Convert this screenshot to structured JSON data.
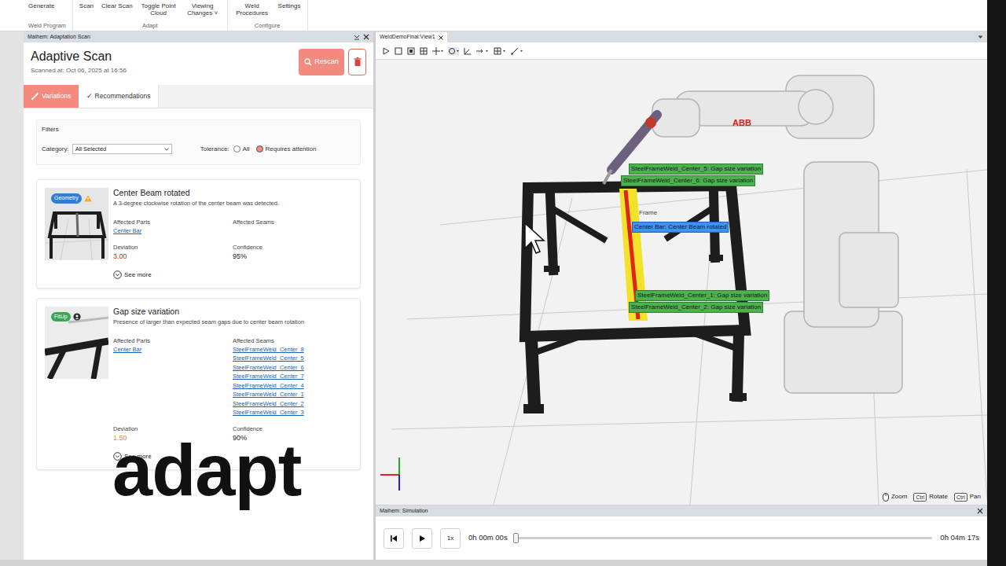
{
  "ribbon": {
    "groups": [
      {
        "label": "Weld Program",
        "items": [
          "Generate"
        ]
      },
      {
        "label": "Adapt",
        "items": [
          "Scan",
          "Clear Scan",
          "Toggle Point Cloud",
          "Viewing Changes ˅"
        ]
      },
      {
        "label": "Configure",
        "items": [
          "Weld Procedures",
          "Settings"
        ]
      }
    ]
  },
  "scan_panel": {
    "title": "Maihem: Adaptation Scan",
    "heading": "Adaptive Scan",
    "scanned_at": "Scanned at: Oct 06, 2025 at 16:56",
    "rescan": "Rescan",
    "tabs": [
      {
        "label": "Variations",
        "selected": true,
        "kind": "icon"
      },
      {
        "label": "✓ Recommendations",
        "selected": false,
        "kind": "plain"
      }
    ],
    "filters": {
      "title": "Filters",
      "category_label": "Category:",
      "category": "All Selected",
      "tolerance_label": "Tolerance:",
      "tolerance": [
        {
          "label": "All",
          "selected": false
        },
        {
          "label": "Requires attention",
          "selected": true
        }
      ]
    },
    "variations": [
      {
        "title": "Center Beam rotated",
        "description": "A 3-degree clockwise rotation of the center beam was detected.",
        "badge": "Geometry",
        "badge_color": "#2f7fd8",
        "flag": "warning",
        "thumb": "frame",
        "parts_label": "Affected Parts",
        "parts": [
          "Center Bar"
        ],
        "seams_label": "Affected Seams",
        "seams": [],
        "deviation_label": "Deviation",
        "deviation": "3.00",
        "deviation_color": "#b83228",
        "confidence_label": "Confidence",
        "confidence": "95%",
        "see_more": "See more"
      },
      {
        "title": "Gap size variation",
        "description": "Presence of larger than expected seam gaps due to center beam rotation",
        "badge": "FitUp",
        "badge_color": "#3aa655",
        "flag": "person",
        "thumb": "closeup",
        "parts_label": "Affected Parts",
        "parts": [
          "Center Bar"
        ],
        "seams_label": "Affected Seams",
        "seams": [
          "SteelFrameWeld_Center_8",
          "SteelFrameWeld_Center_5",
          "SteelFrameWeld_Center_6",
          "SteelFrameWeld_Center_7",
          "SteelFrameWeld_Center_4",
          "SteelFrameWeld_Center_1",
          "SteelFrameWeld_Center_2",
          "SteelFrameWeld_Center_3"
        ],
        "deviation_label": "Deviation",
        "deviation": "1.50",
        "deviation_color": "#d9901a",
        "confidence_label": "Confidence",
        "confidence": "90%",
        "see_more": "See more"
      }
    ]
  },
  "caption": "adapt",
  "viewport": {
    "tab": "WeldDemoFinal:View1",
    "labels": [
      {
        "text": "SteelFrameWeld_Center_5: Gap size variation",
        "kind": "weld"
      },
      {
        "text": "SteelFrameWeld_Center_6: Gap size variation",
        "kind": "weld"
      },
      {
        "text": "Frame",
        "kind": "plain"
      },
      {
        "text": "Center Bar: Center Beam rotated",
        "kind": "part"
      },
      {
        "text": "SteelFrameWeld_Center_1: Gap size variation",
        "kind": "weld"
      },
      {
        "text": "SteelFrameWeld_Center_2: Gap size variation",
        "kind": "weld"
      }
    ],
    "brand": "ABB",
    "hints": [
      {
        "kind": "mouse",
        "key": "",
        "action": "Zoom"
      },
      {
        "kind": "key",
        "key": "Ctrl",
        "action": "Rotate"
      },
      {
        "kind": "key",
        "key": "Ctrl",
        "action": "Pan"
      }
    ]
  },
  "simulation": {
    "title": "Maihem: Simulation",
    "speed": "1x",
    "current_time": "0h 00m 00s",
    "total_time": "0h 04m 17s",
    "level": 0,
    "playing": false
  }
}
